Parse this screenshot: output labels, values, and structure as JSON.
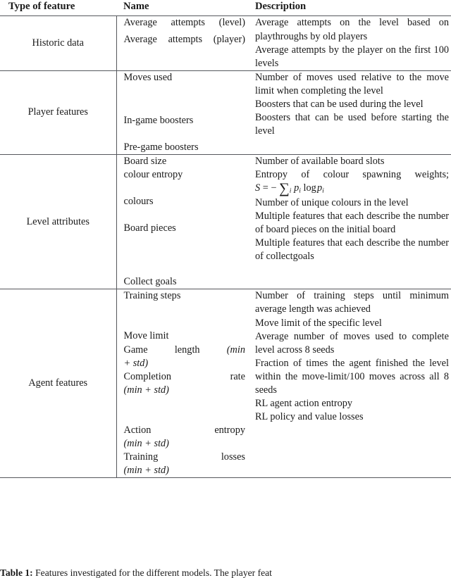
{
  "table": {
    "headers": {
      "type": "Type of feature",
      "name": "Name",
      "description": "Description"
    },
    "groups": [
      {
        "type": "Historic data",
        "rows": [
          {
            "name": "Average attempts (level)",
            "description": "Average attempts on the level based on playthroughs by old players"
          },
          {
            "name": "Average attempts (player)",
            "description": "Average attempts by the player on the first 100 levels"
          }
        ]
      },
      {
        "type": "Player features",
        "rows": [
          {
            "name": "Moves used",
            "description": "Number of moves used relative to the move limit when completing the level"
          },
          {
            "name": "In-game boosters",
            "description": "Boosters that can be used during the level"
          },
          {
            "name": "Pre-game boosters",
            "description": "Boosters that can be used before starting the level"
          }
        ]
      },
      {
        "type": "Level attributes",
        "rows": [
          {
            "name": "Board size",
            "description": "Number of available board slots"
          },
          {
            "name": "colour entropy",
            "description": "Entropy of colour spawning weights;",
            "formula": "S = − ∑i pi log pi"
          },
          {
            "name": "colours",
            "description": "Number of unique colours in the level"
          },
          {
            "name": "Board pieces",
            "description": "Multiple features that each describe the number of board pieces on the initial board"
          },
          {
            "name": "Collect goals",
            "description": "Multiple features that each describe the number of collectgoals"
          }
        ]
      },
      {
        "type": "Agent features",
        "rows": [
          {
            "name": "Training steps",
            "description": "Number of training steps until minimum average length was achieved"
          },
          {
            "name": "Move limit",
            "description": "Move limit of the specific level"
          },
          {
            "name": "Game length",
            "name_suffix": "(min + std)",
            "description": "Average number of moves used to complete level across 8 seeds"
          },
          {
            "name": "Completion rate",
            "name_suffix": "(min + std)",
            "description": "Fraction of times the agent finished the level within the move-limit/100 moves across all 8 seeds"
          },
          {
            "name": "Action entropy",
            "name_suffix": "(min + std)",
            "description": "RL agent action entropy"
          },
          {
            "name": "Training losses",
            "name_suffix": "(min + std)",
            "description": "RL policy and value losses"
          }
        ]
      }
    ]
  },
  "caption": {
    "label": "Table 1:",
    "text": "Features investigated for the different models. The player feat"
  },
  "colors": {
    "rule": "#55575c",
    "text": "#1a1a1a",
    "background": "#ffffff"
  }
}
